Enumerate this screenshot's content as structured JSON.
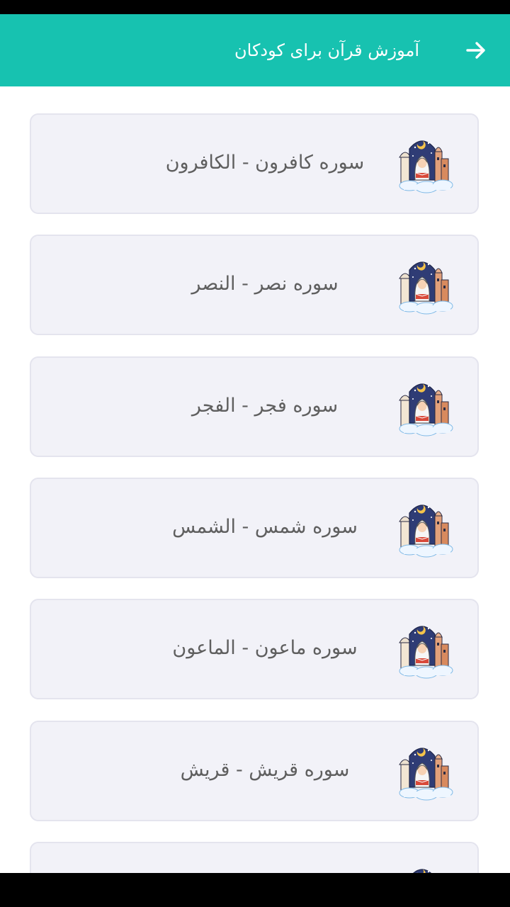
{
  "toolbar": {
    "title": "آموزش قرآن برای کودکان",
    "back_icon": "arrow-right-icon",
    "color": "#17c2b0"
  },
  "list": {
    "thumbnail_icon": "child-reading-quran-icon",
    "items": [
      {
        "label": "سوره کافرون - الکافرون"
      },
      {
        "label": "سوره نصر - النصر"
      },
      {
        "label": "سوره فجر - الفجر"
      },
      {
        "label": "سوره شمس - الشمس"
      },
      {
        "label": "سوره ماعون - الماعون"
      },
      {
        "label": "سوره قریش - قریش"
      },
      {
        "label": ""
      }
    ]
  }
}
